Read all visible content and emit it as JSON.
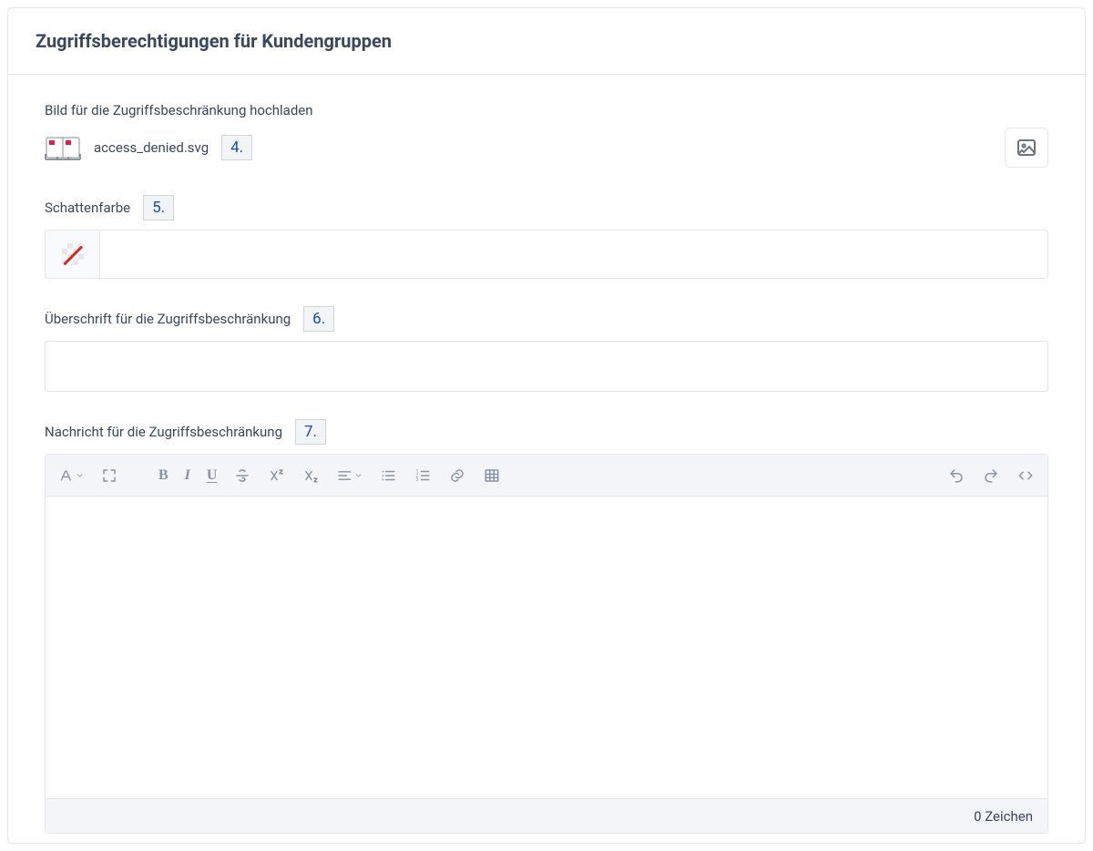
{
  "header": {
    "title": "Zugriffsberechtigungen für Kundengruppen"
  },
  "upload": {
    "label": "Bild für die Zugriffsbeschränkung hochladen",
    "file_name": "access_denied.svg"
  },
  "annotations": {
    "slot4": "4.",
    "slot5": "5.",
    "slot6": "6.",
    "slot7": "7."
  },
  "shadow_color": {
    "label": "Schattenfarbe",
    "value": ""
  },
  "headline": {
    "label": "Überschrift für die Zugriffsbeschränkung",
    "value": ""
  },
  "message": {
    "label": "Nachricht für die Zugriffsbeschränkung",
    "char_count": "0 Zeichen"
  }
}
